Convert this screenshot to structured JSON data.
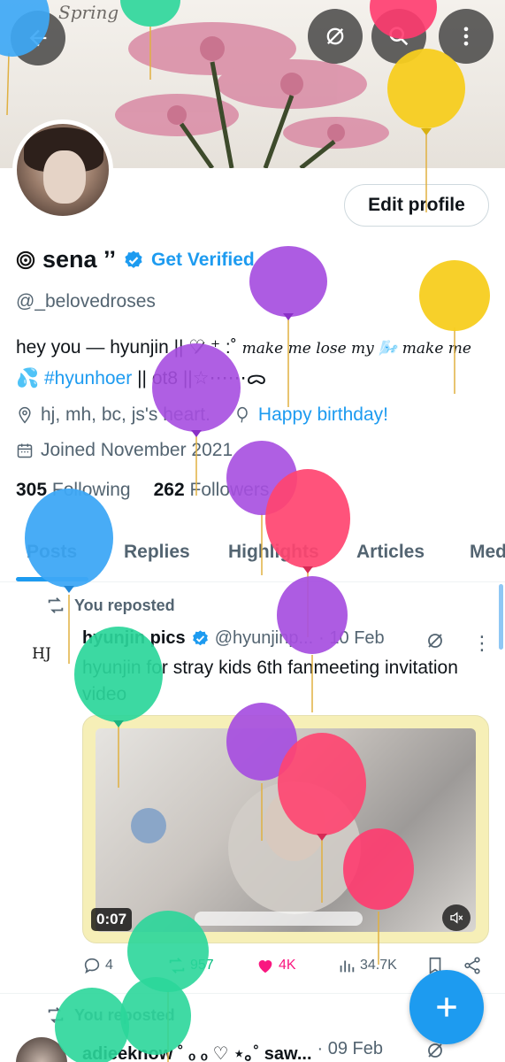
{
  "banner": {
    "word": "Spring"
  },
  "nav": {
    "back_icon": "back-arrow-icon",
    "grok_icon": "grok-icon",
    "search_icon": "search-icon",
    "more_icon": "more-vertical-icon"
  },
  "profile": {
    "edit_label": "Edit profile",
    "display_name": "sena ’’",
    "get_verified": "Get Verified",
    "handle": "@_belovedroses",
    "bio_line1_a": "hey you — hyunjin || ♡̷ ⁺ :˚ ",
    "bio_line1_script": "make me lose my 🌬️ make me",
    "bio_line2_emoji": "💦 ",
    "bio_hashtag": "#hyunhoer",
    "bio_line2_rest": " || ot8 ||☆⋯⋯ᯅ",
    "location": "hj, mh, bc, js's heart.",
    "birthday": "Happy birthday!",
    "joined": "Joined November 2021",
    "following_count": "305",
    "following_label": "Following",
    "followers_count": "262",
    "followers_label": "Followers"
  },
  "tabs": [
    "Posts",
    "Replies",
    "Highlights",
    "Articles",
    "Media"
  ],
  "post1": {
    "repost_label": "You reposted",
    "avatar_text": "HJ",
    "name": "hyunjin pics",
    "handle": "@hyunjinp...",
    "date": "· 10 Feb",
    "text": "hyunjin for stray kids 6th fanmeeting invitation video",
    "duration": "0:07",
    "replies": "4",
    "reposts": "957",
    "likes": "4K",
    "views": "34.7K"
  },
  "post2": {
    "repost_label": "You reposted",
    "name": "adieeknow ˚ ₒ ₒ ♡ ⋆｡˚ saw...",
    "date": "· 09 Feb"
  },
  "colors": {
    "accent": "#1d9bf0",
    "like": "#f91880",
    "text": "#0f1419",
    "muted": "#536471"
  }
}
